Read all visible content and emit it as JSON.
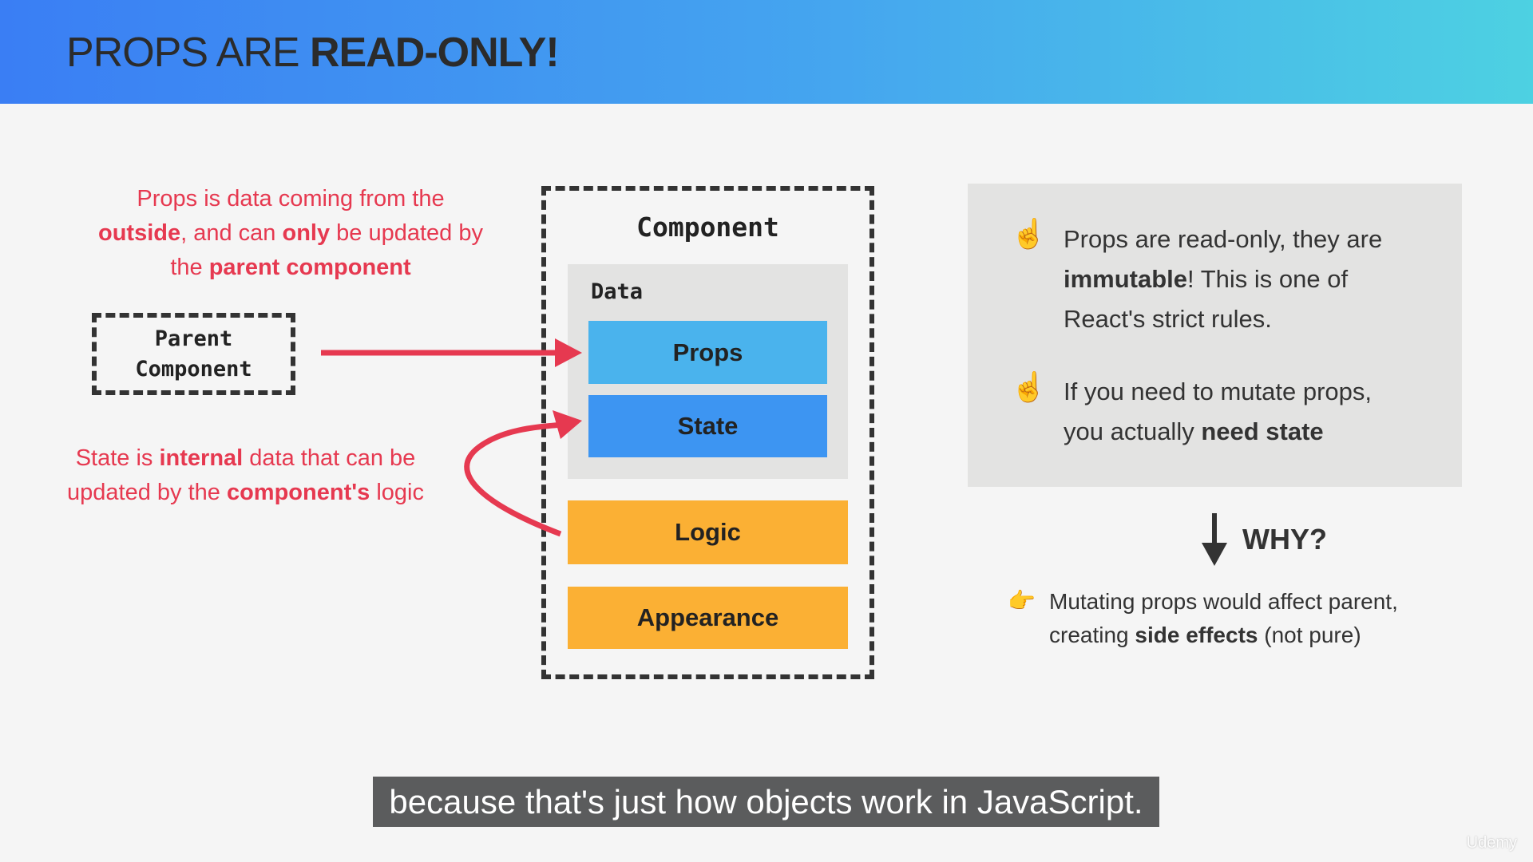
{
  "header": {
    "title_regular": "PROPS ARE ",
    "title_bold": "READ-ONLY!"
  },
  "colors": {
    "accent_red": "#e63950",
    "props": "#4ab3ed",
    "state": "#3d95f2",
    "logic": "#fbb034",
    "appearance": "#fbb034"
  },
  "left": {
    "props_note": {
      "l1": "Props is data coming from the",
      "l2a": "outside",
      "l2b": ", and can ",
      "l2c": "only",
      "l2d": " be updated by",
      "l3a": "the ",
      "l3b": "parent component"
    },
    "parent_box": {
      "l1": "Parent",
      "l2": "Component"
    },
    "state_note": {
      "l1a": "State is ",
      "l1b": "internal",
      "l1c": " data that can be",
      "l2a": "updated by the ",
      "l2b": "component's",
      "l2c": " logic"
    }
  },
  "component": {
    "title": "Component",
    "data_label": "Data",
    "props": "Props",
    "state": "State",
    "logic": "Logic",
    "appearance": "Appearance"
  },
  "right": {
    "bullet1": {
      "icon": "index-pointing-up-emoji",
      "l1": "Props are read-only, they are",
      "l2a": "immutable",
      "l2b": "! This is one of",
      "l3": "React's strict rules."
    },
    "bullet2": {
      "icon": "index-pointing-up-emoji",
      "l1": "If you need to mutate props,",
      "l2a": "you actually ",
      "l2b": "need state"
    },
    "why": "WHY?",
    "reason": {
      "icon": "pointing-right-emoji",
      "l1": "Mutating props would affect parent,",
      "l2a": "creating ",
      "l2b": "side effects",
      "l2c": " (not pure)"
    }
  },
  "caption": "because that's just how objects work in JavaScript.",
  "watermark": "Udemy"
}
